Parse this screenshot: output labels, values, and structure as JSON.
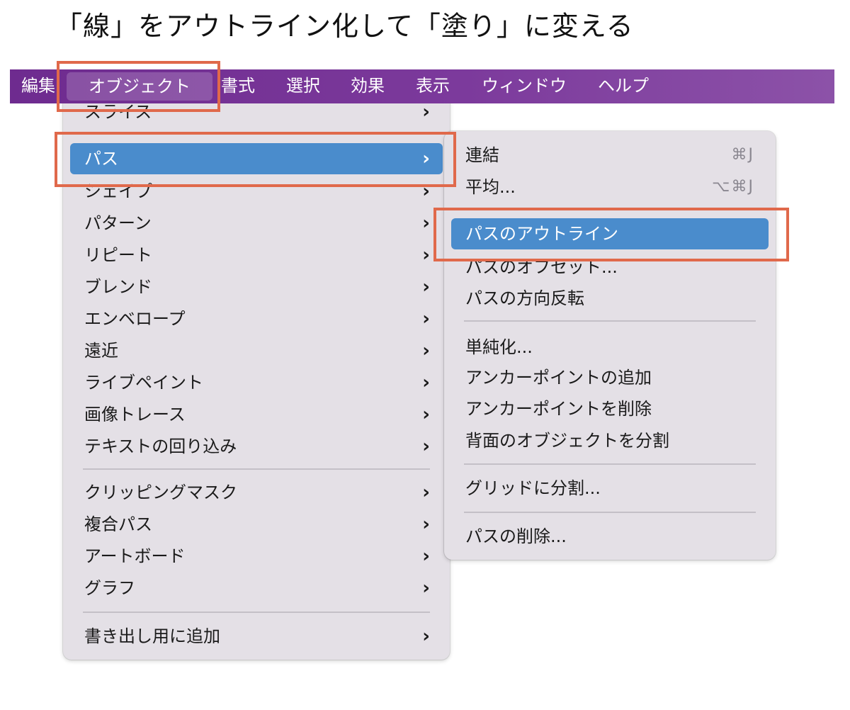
{
  "page_title": "「線」をアウトライン化して「塗り」に変える",
  "colors": {
    "menubar": "#7c3a9c",
    "menu_bg": "#e4e0e6",
    "selection": "#4a8ccc",
    "highlight": "#e0694b"
  },
  "menubar": {
    "items": [
      "編集",
      "オブジェクト",
      "書式",
      "選択",
      "効果",
      "表示",
      "ウィンドウ",
      "ヘルプ"
    ],
    "active": "オブジェクト"
  },
  "object_menu": {
    "items": [
      {
        "label": "スライス",
        "submenu": true
      },
      {
        "label": "パス",
        "submenu": true,
        "selected": true
      },
      {
        "label": "シェイプ",
        "submenu": true
      },
      {
        "label": "パターン",
        "submenu": true
      },
      {
        "label": "リピート",
        "submenu": true
      },
      {
        "label": "ブレンド",
        "submenu": true
      },
      {
        "label": "エンベロープ",
        "submenu": true
      },
      {
        "label": "遠近",
        "submenu": true
      },
      {
        "label": "ライブペイント",
        "submenu": true
      },
      {
        "label": "画像トレース",
        "submenu": true
      },
      {
        "label": "テキストの回り込み",
        "submenu": true
      },
      {
        "label": "クリッピングマスク",
        "submenu": true
      },
      {
        "label": "複合パス",
        "submenu": true
      },
      {
        "label": "アートボード",
        "submenu": true
      },
      {
        "label": "グラフ",
        "submenu": true
      },
      {
        "label": "書き出し用に追加",
        "submenu": true
      }
    ],
    "chevron_icon": "chevron-right-icon"
  },
  "path_submenu": {
    "items": [
      {
        "label": "連結",
        "shortcut": "⌘J"
      },
      {
        "label": "平均...",
        "shortcut": "⌥⌘J"
      },
      {
        "label": "パスのアウトライン",
        "selected": true
      },
      {
        "label": "パスのオフセット..."
      },
      {
        "label": "パスの方向反転"
      },
      {
        "label": "単純化..."
      },
      {
        "label": "アンカーポイントの追加"
      },
      {
        "label": "アンカーポイントを削除"
      },
      {
        "label": "背面のオブジェクトを分割"
      },
      {
        "label": "グリッドに分割..."
      },
      {
        "label": "パスの削除..."
      }
    ]
  }
}
